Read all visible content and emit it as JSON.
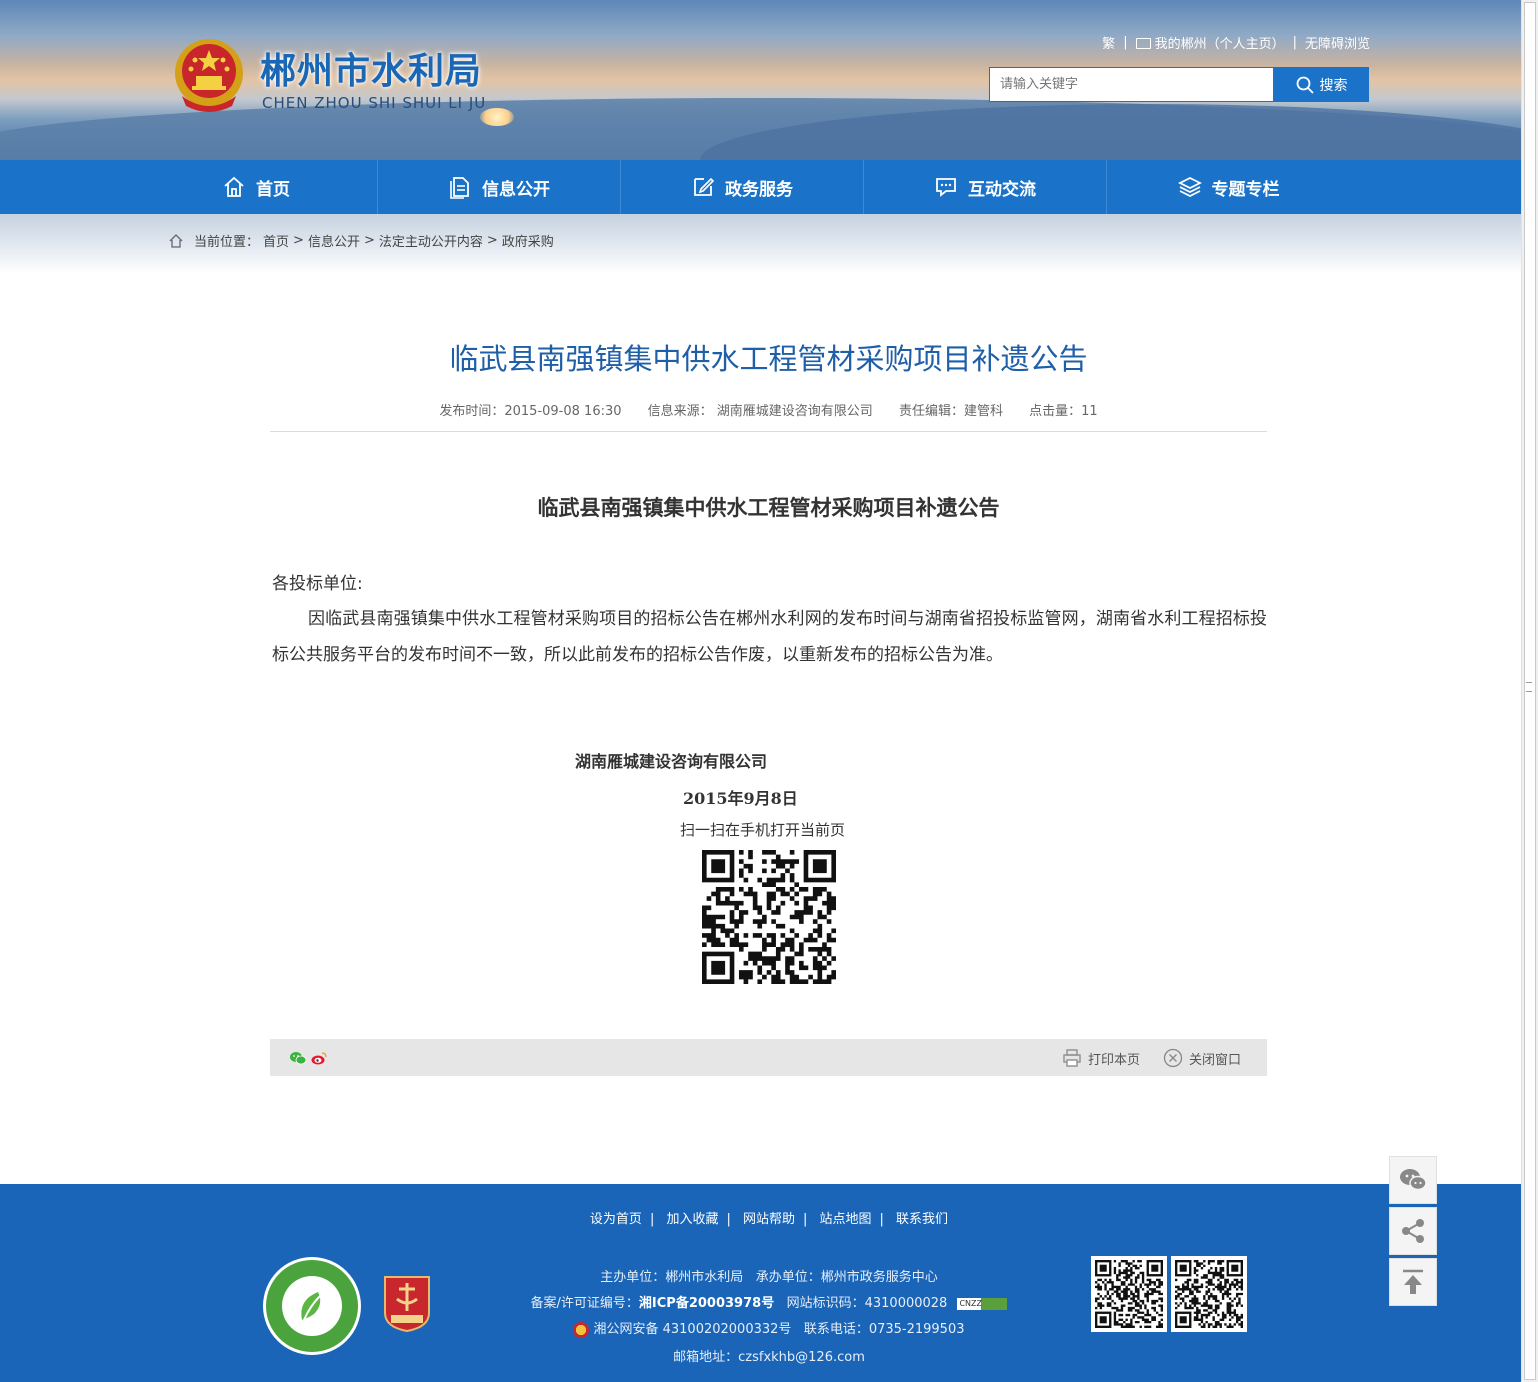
{
  "header": {
    "title": "郴州市水利局",
    "subtitle": "CHEN ZHOU SHI SHUI LI JU",
    "links": [
      "繁",
      "我的郴州（个人主页）",
      "无障碍浏览"
    ],
    "search_placeholder": "请输入关键字",
    "search_button": "搜索"
  },
  "nav": {
    "items": [
      "首页",
      "信息公开",
      "政务服务",
      "互动交流",
      "专题专栏"
    ]
  },
  "breadcrumb": {
    "label": "当前位置：",
    "items": [
      "首页",
      "信息公开",
      "法定主动公开内容",
      "政府采购"
    ],
    "separator": ">"
  },
  "article": {
    "title": "临武县南强镇集中供水工程管材采购项目补遗公告",
    "meta": {
      "publish_time": "发布时间：2015-09-08 16:30",
      "source": "信息来源： 湖南雁城建设咨询有限公司",
      "editor": "责任编辑：建管科",
      "hits": "点击量：11"
    },
    "heading": "临武县南强镇集中供水工程管材采购项目补遗公告",
    "greeting": "各投标单位:",
    "body": "因临武县南强镇集中供水工程管材采购项目的招标公告在郴州水利网的发布时间与湖南省招投标监管网，湖南省水利工程招标投标公共服务平台的发布时间不一致，所以此前发布的招标公告作废，以重新发布的招标公告为准。",
    "signature": "湖南雁城建设咨询有限公司",
    "date": "2015年9月8日",
    "scan_text": "扫一扫在手机打开当前页"
  },
  "toolbar": {
    "print": "打印本页",
    "close": "关闭窗口"
  },
  "footer": {
    "links": [
      "设为首页",
      "加入收藏",
      "网站帮助",
      "站点地图",
      "联系我们"
    ],
    "sponsor": "主办单位：郴州市水利局",
    "organizer": "承办单位：郴州市政务服务中心",
    "icp_label": "备案/许可证编号：",
    "icp": "湘ICP备20003978号",
    "site_code": "网站标识码：4310000028",
    "police": "湘公网安备 43100202000332号",
    "phone": "联系电话：0735-2199503",
    "email": "邮箱地址：czsfxkhb@126.com",
    "cnzz": "CNZZ"
  },
  "colors": {
    "primary": "#1a73c9",
    "footer": "#1a65b8",
    "title": "#1f5fa8"
  }
}
